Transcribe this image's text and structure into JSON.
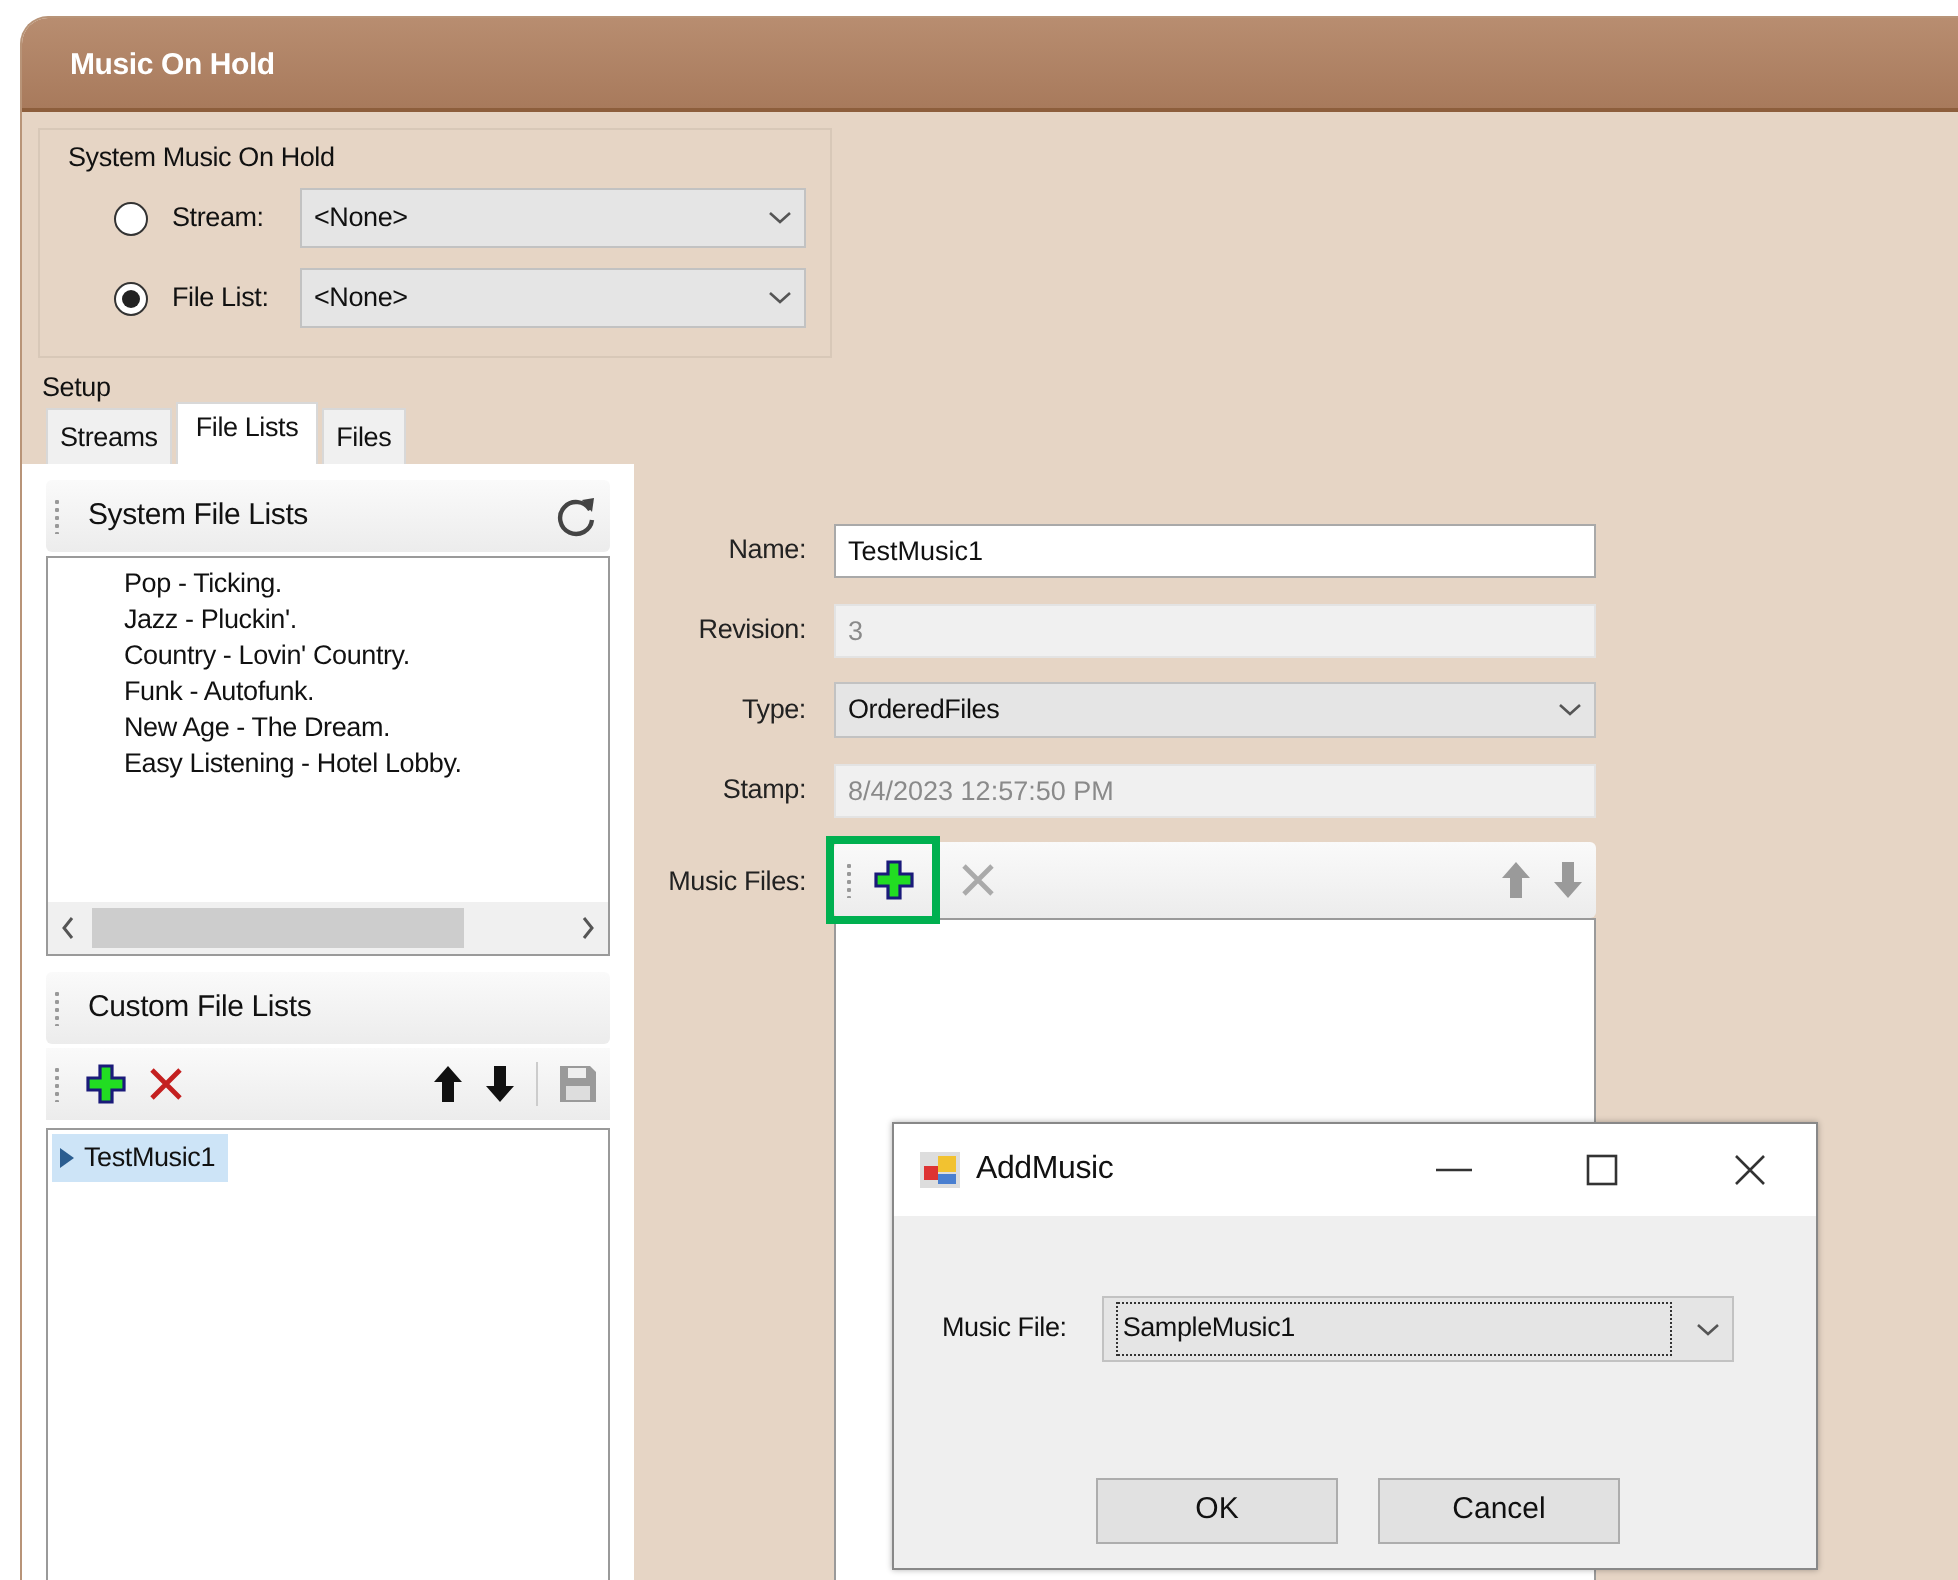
{
  "window": {
    "title": "Music On Hold"
  },
  "system_music_on_hold": {
    "title": "System Music On Hold",
    "options": [
      {
        "label": "Stream:",
        "selected": false,
        "value": "<None>"
      },
      {
        "label": "File List:",
        "selected": true,
        "value": "<None>"
      }
    ]
  },
  "setup": {
    "title": "Setup",
    "tabs": [
      {
        "label": "Streams",
        "selected": false
      },
      {
        "label": "File Lists",
        "selected": true
      },
      {
        "label": "Files",
        "selected": false
      }
    ]
  },
  "system_file_lists": {
    "title": "System File Lists",
    "items": [
      "Pop - Ticking.",
      "Jazz - Pluckin'.",
      "Country - Lovin' Country.",
      "Funk - Autofunk.",
      "New Age - The Dream.",
      "Easy Listening - Hotel Lobby."
    ]
  },
  "custom_file_lists": {
    "title": "Custom File Lists",
    "tools": [
      {
        "kind": "add",
        "disabled": false
      },
      {
        "kind": "delete",
        "disabled": false
      },
      {
        "kind": "up",
        "disabled": false
      },
      {
        "kind": "down",
        "disabled": false
      },
      {
        "kind": "save",
        "disabled": true
      }
    ],
    "items": [
      {
        "label": "TestMusic1",
        "selected": true
      }
    ]
  },
  "form": {
    "fields": [
      {
        "label": "Name:",
        "value": "TestMusic1",
        "kind": "text",
        "disabled": false
      },
      {
        "label": "Revision:",
        "value": "3",
        "kind": "text",
        "disabled": true
      },
      {
        "label": "Type:",
        "value": "OrderedFiles",
        "kind": "select",
        "disabled": false
      },
      {
        "label": "Stamp:",
        "value": "8/4/2023 12:57:50 PM",
        "kind": "text",
        "disabled": true
      }
    ],
    "music_files": {
      "label": "Music Files:",
      "tools": [
        {
          "kind": "add",
          "disabled": false,
          "highlighted": true
        },
        {
          "kind": "delete",
          "disabled": true,
          "highlighted": false
        },
        {
          "kind": "up",
          "disabled": true,
          "highlighted": false
        },
        {
          "kind": "down",
          "disabled": true,
          "highlighted": false
        }
      ]
    }
  },
  "dialog": {
    "title": "AddMusic",
    "field": {
      "label": "Music File:",
      "value": "SampleMusic1"
    },
    "buttons": [
      "OK",
      "Cancel"
    ]
  }
}
